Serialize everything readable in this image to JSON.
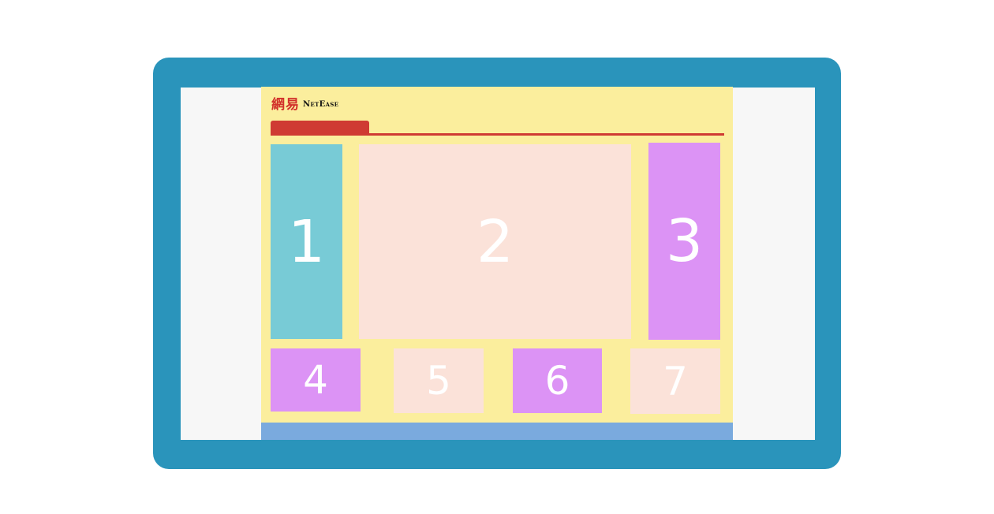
{
  "logo": {
    "glyph": "網易",
    "text": "NetEase"
  },
  "blocks": [
    "1",
    "2",
    "3",
    "4",
    "5",
    "6",
    "7"
  ],
  "colors": {
    "monitor_frame": "#2a94bb",
    "screen": "#f7f7f7",
    "page": "#fbee9d",
    "nav": "#cf3a33",
    "teal": "#78cbd6",
    "peach": "#fbe2d9",
    "purple": "#dc93f5",
    "footer": "#7aaade"
  }
}
